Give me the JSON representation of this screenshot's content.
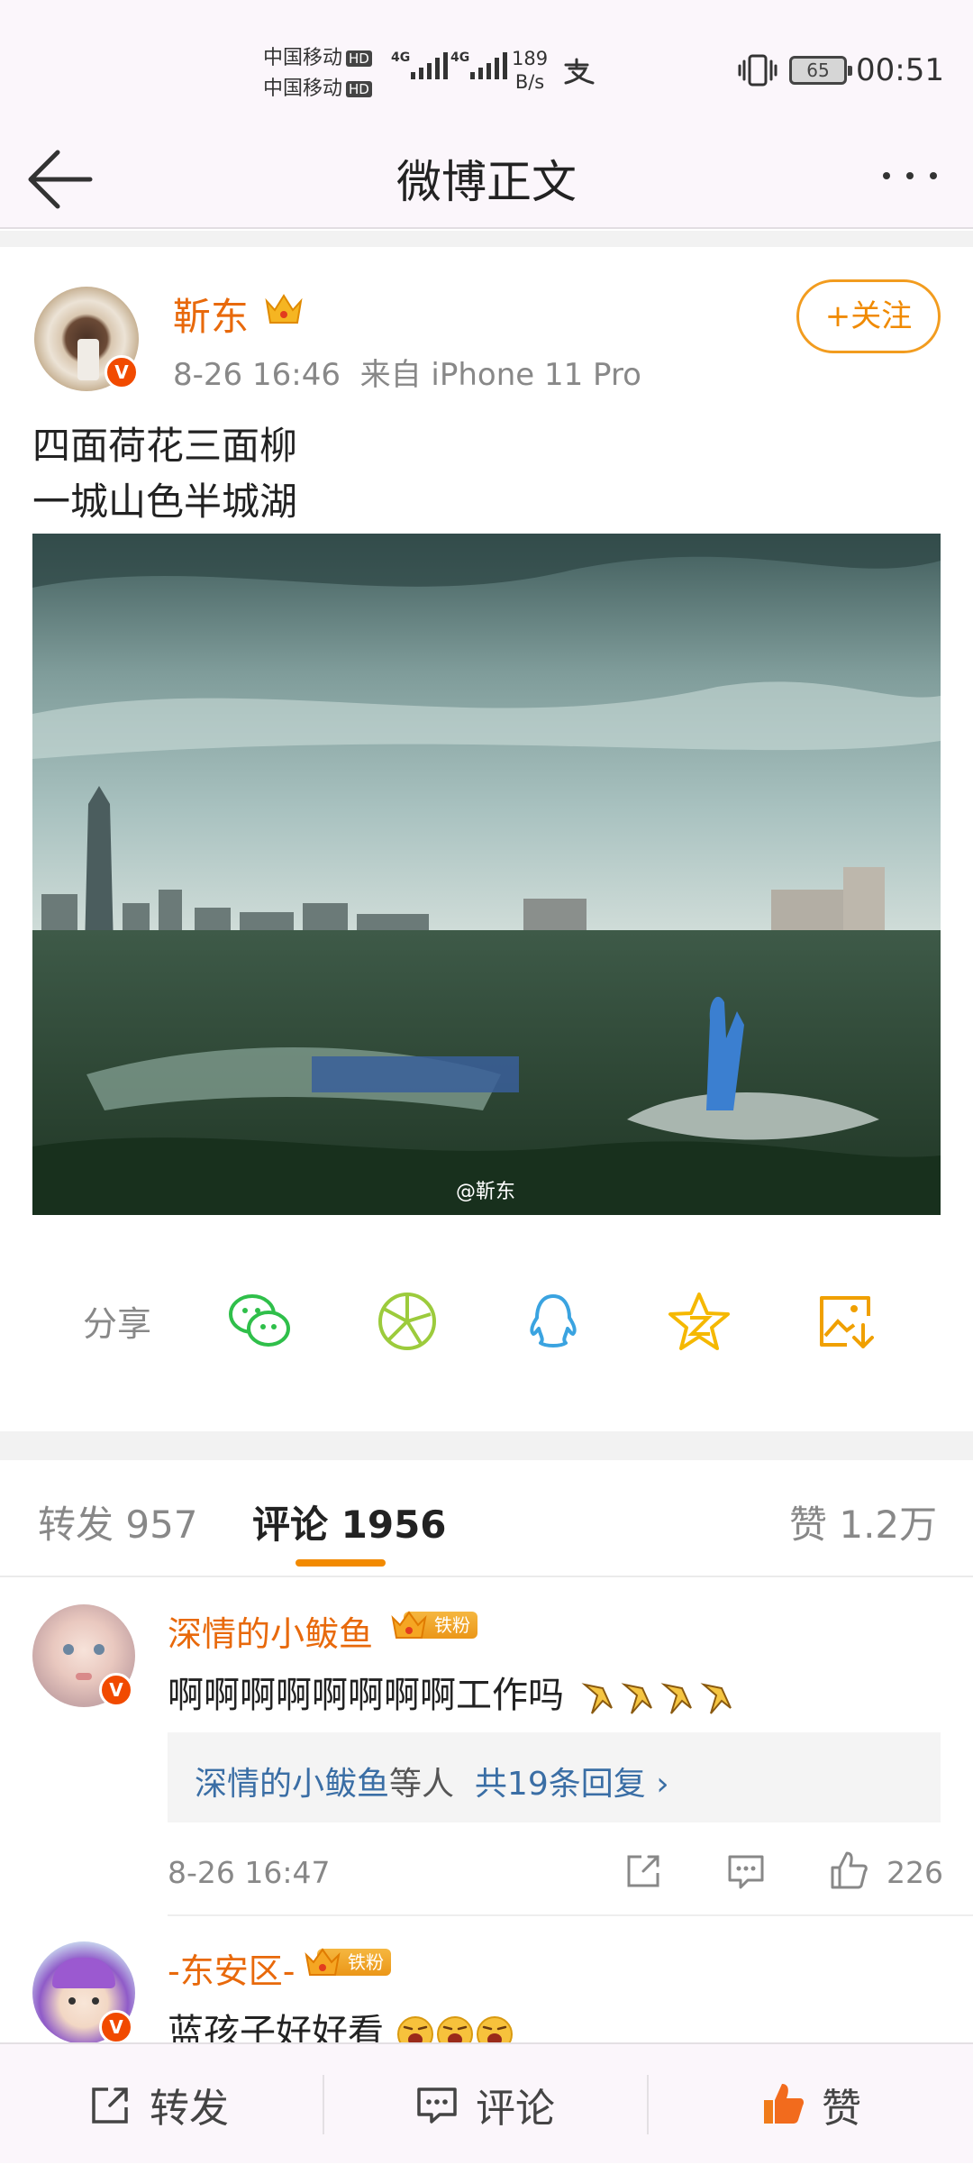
{
  "status_bar": {
    "carrier_1": "中国移动",
    "carrier_2": "中国移动",
    "hd_1": "HD",
    "hd_2": "HD",
    "network_1": "4G",
    "network_2": "4G",
    "net_speed_value": "189",
    "net_speed_unit": "B/s",
    "battery": "65",
    "time": "00:51"
  },
  "header": {
    "title": "微博正文"
  },
  "post": {
    "author": "靳东",
    "verified_badge": "V",
    "time": "8-26 16:46",
    "source": "来自 iPhone 11 Pro",
    "follow_label": "+关注",
    "text_line1": "四面荷花三面柳",
    "text_line2": "一城山色半城湖",
    "image_watermark": "@靳东"
  },
  "share": {
    "label": "分享",
    "icons": [
      "wechat-icon",
      "moments-icon",
      "qq-icon",
      "qzone-icon",
      "save-image-icon"
    ]
  },
  "tabs": {
    "repost": "转发 957",
    "comment": "评论 1956",
    "like": "赞 1.2万"
  },
  "comments": [
    {
      "user": "深情的小鲅鱼",
      "fan_label": "铁粉",
      "text": "啊啊啊啊啊啊啊啊工作吗",
      "reply_user": "深情的小鲅鱼",
      "reply_suffix": "等人",
      "reply_count": "共19条回复",
      "reply_arrow": "›",
      "time": "8-26 16:47",
      "likes": "226"
    },
    {
      "user": "-东安区-",
      "fan_label": "铁粉",
      "text": "蓝孩子好好看"
    }
  ],
  "bottom_bar": {
    "repost": "转发",
    "comment": "评论",
    "like": "赞"
  },
  "colors": {
    "accent_orange": "#e8690b",
    "follow_border": "#f29c1f",
    "tab_indicator": "#f28a00",
    "link_blue": "#3a6ea5"
  }
}
